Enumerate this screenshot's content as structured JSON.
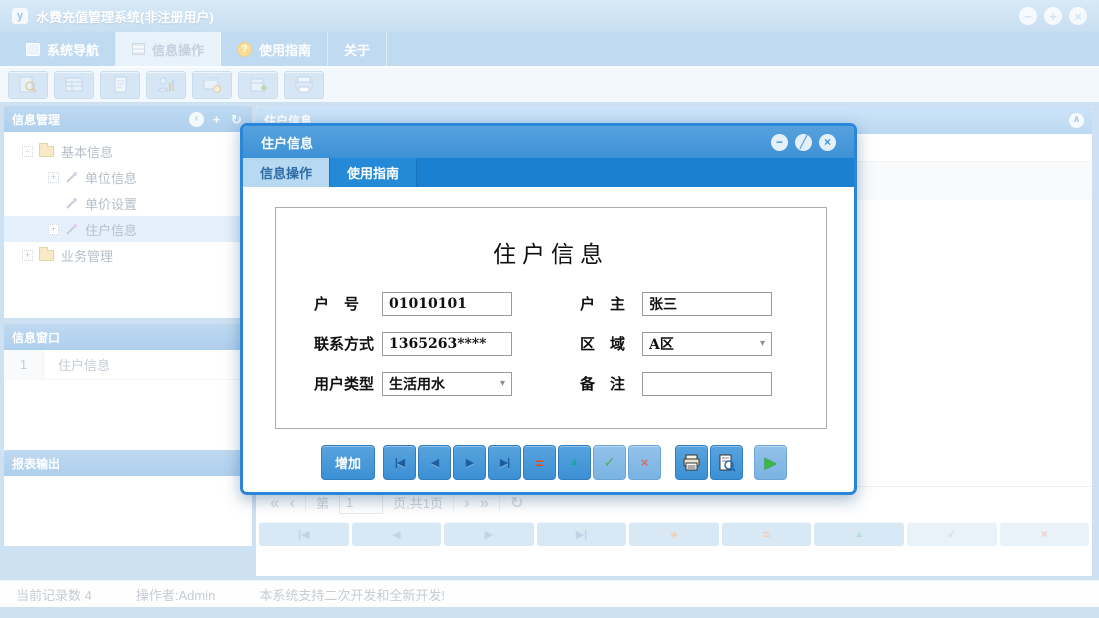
{
  "window": {
    "title": "水费充值管理系统(非注册用户)",
    "app_icon_letter": "y"
  },
  "main_tabs": {
    "items": [
      {
        "label": "系统导航"
      },
      {
        "label": "信息操作",
        "active": true
      },
      {
        "label": "使用指南"
      },
      {
        "label": "关于"
      }
    ]
  },
  "toolbar": {
    "icons": [
      "search-document",
      "table-view",
      "document",
      "user-report",
      "window-view",
      "document-add",
      "printer"
    ]
  },
  "sidebar": {
    "info_manage": {
      "title": "信息管理"
    },
    "tree": {
      "items": [
        {
          "label": "基本信息",
          "expander": "−",
          "type": "folder"
        },
        {
          "label": "单位信息",
          "expander": "+",
          "type": "leaf"
        },
        {
          "label": "单价设置",
          "expander": "",
          "type": "leaf"
        },
        {
          "label": "住户信息",
          "expander": "+",
          "type": "leaf",
          "selected": true
        },
        {
          "label": "业务管理",
          "expander": "+",
          "type": "folder"
        }
      ]
    },
    "info_window": {
      "title": "信息窗口",
      "rows": [
        {
          "index": "1",
          "label": "住户信息"
        }
      ]
    },
    "report_output": {
      "title": "报表输出"
    }
  },
  "main_panel": {
    "title": "住户信息",
    "pagination": {
      "prefix": "第",
      "page_value": "1",
      "suffix": "页,共1页"
    }
  },
  "status_bar": {
    "record_count": "当前记录数 4",
    "operator": "操作者:Admin",
    "message": "本系统支持二次开发和全新开发!"
  },
  "dialog": {
    "title": "住户信息",
    "tabs": [
      {
        "label": "信息操作",
        "active": true
      },
      {
        "label": "使用指南"
      }
    ],
    "form": {
      "heading": "住户信息",
      "fields": [
        {
          "label": "户　号",
          "value": "01010101",
          "type": "text"
        },
        {
          "label": "户　主",
          "value": "张三",
          "type": "text"
        },
        {
          "label": "联系方式",
          "value": "1365263****",
          "type": "text"
        },
        {
          "label": "区　域",
          "value": "A区",
          "type": "select"
        },
        {
          "label": "用户类型",
          "value": "生活用水",
          "type": "select"
        },
        {
          "label": "备　注",
          "value": "",
          "type": "text"
        }
      ]
    },
    "buttons": {
      "add_label": "增加"
    }
  },
  "icons": {
    "minimize": "−",
    "maximize": "+",
    "close": "×",
    "pin": "╱",
    "chevron_left": "‹",
    "chevron_up": "∧",
    "plus": "+",
    "refresh": "↻",
    "page_first": "«",
    "page_prev": "‹",
    "page_next": "›",
    "page_last": "»",
    "dropdown": "▾",
    "nav_first": "|◀",
    "nav_prev": "◀",
    "nav_next": "▶",
    "nav_last": "▶|",
    "row_add": "+",
    "row_delete": "=",
    "row_up": "▲",
    "ok": "✓",
    "cancel": "×",
    "run": "▶",
    "help": "?"
  },
  "colors": {
    "accent_blue": "#3d91d6",
    "tab_strip_blue": "#1c80d0",
    "chrome_light_blue": "#a6c9e8",
    "selected_row": "#cfe5f8",
    "folder_yellow": "#f0d998",
    "delete_red": "#e84a1c",
    "ok_green": "#53a85f",
    "run_green": "#3cb54a"
  }
}
